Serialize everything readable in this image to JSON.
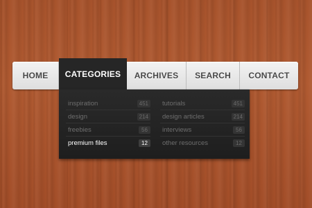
{
  "nav": {
    "items": [
      {
        "label": "HOME"
      },
      {
        "label": "CATEGORIES",
        "active": true
      },
      {
        "label": "ARCHIVES"
      },
      {
        "label": "SEARCH"
      },
      {
        "label": "CONTACT"
      }
    ]
  },
  "dropdown": {
    "left": [
      {
        "label": "inspiration",
        "count": "451"
      },
      {
        "label": "design",
        "count": "214"
      },
      {
        "label": "freebies",
        "count": "56"
      },
      {
        "label": "premium files",
        "count": "12",
        "highlighted": true
      }
    ],
    "right": [
      {
        "label": "tutorials",
        "count": "451"
      },
      {
        "label": "design articles",
        "count": "214"
      },
      {
        "label": "interviews",
        "count": "56"
      },
      {
        "label": "other resources",
        "count": "12"
      }
    ]
  },
  "colors": {
    "active_tab": "#262626",
    "dropdown_bg": "#222222",
    "wood": "#a7532c"
  }
}
